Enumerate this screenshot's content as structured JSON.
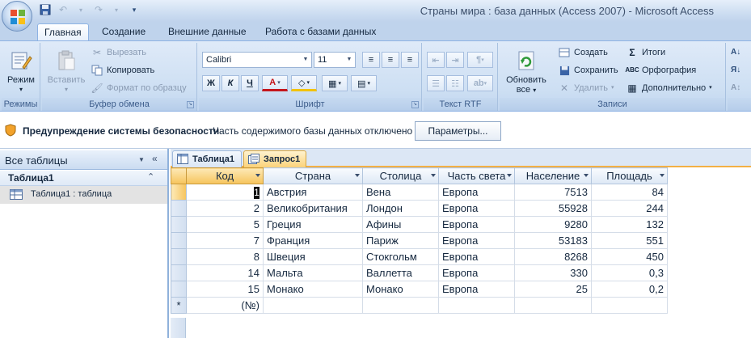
{
  "window": {
    "title": "Страны мира : база данных (Access 2007) - Microsoft Access"
  },
  "colors": {
    "ribbon": "#cddff3",
    "accent": "#f6c45c",
    "frame": "#8fb1db"
  },
  "quick_access": [
    "save-icon",
    "undo-icon",
    "redo-icon",
    "customize-icon"
  ],
  "ribbon_tabs": [
    {
      "label": "Главная",
      "active": true
    },
    {
      "label": "Создание",
      "active": false
    },
    {
      "label": "Внешние данные",
      "active": false
    },
    {
      "label": "Работа с базами данных",
      "active": false
    }
  ],
  "ribbon": {
    "views": {
      "group": "Режимы",
      "mode": "Режим"
    },
    "clipboard": {
      "group": "Буфер обмена",
      "paste": "Вставить",
      "cut": "Вырезать",
      "copy": "Копировать",
      "format_painter": "Формат по образцу"
    },
    "font": {
      "group": "Шрифт",
      "font_name": "Calibri",
      "font_size": "11",
      "bold": "Ж",
      "italic": "К",
      "underline": "Ч",
      "font_color": "A"
    },
    "rtf": {
      "group": "Текст RTF"
    },
    "records": {
      "group": "Записи",
      "refresh": "Обновить",
      "refresh2": "все",
      "new": "Создать",
      "save": "Сохранить",
      "delete": "Удалить",
      "totals": "Итоги",
      "spelling": "Орфография",
      "more": "Дополнительно"
    }
  },
  "security": {
    "title": "Предупреждение системы безопасности",
    "message": "Часть содержимого базы данных отключено",
    "button": "Параметры..."
  },
  "nav": {
    "header": "Все таблицы",
    "group": "Таблица1",
    "item": "Таблица1 : таблица"
  },
  "doc_tabs": [
    {
      "label": "Таблица1",
      "active": false
    },
    {
      "label": "Запрос1",
      "active": true
    }
  ],
  "columns": [
    "Код",
    "Страна",
    "Столица",
    "Часть света",
    "Население",
    "Площадь"
  ],
  "rows": [
    {
      "id": "1",
      "country": "Австрия",
      "capital": "Вена",
      "region": "Европа",
      "population": "7513",
      "area": "84"
    },
    {
      "id": "2",
      "country": "Великобритания",
      "capital": "Лондон",
      "region": "Европа",
      "population": "55928",
      "area": "244"
    },
    {
      "id": "5",
      "country": "Греция",
      "capital": "Афины",
      "region": "Европа",
      "population": "9280",
      "area": "132"
    },
    {
      "id": "7",
      "country": "Франция",
      "capital": "Париж",
      "region": "Европа",
      "population": "53183",
      "area": "551"
    },
    {
      "id": "8",
      "country": "Швеция",
      "capital": "Стокгольм",
      "region": "Европа",
      "population": "8268",
      "area": "450"
    },
    {
      "id": "14",
      "country": "Мальта",
      "capital": "Валлетта",
      "region": "Европа",
      "population": "330",
      "area": "0,3"
    },
    {
      "id": "15",
      "country": "Монако",
      "capital": "Монако",
      "region": "Европа",
      "population": "25",
      "area": "0,2"
    }
  ],
  "new_row": {
    "marker": "*",
    "placeholder": "(№)"
  }
}
